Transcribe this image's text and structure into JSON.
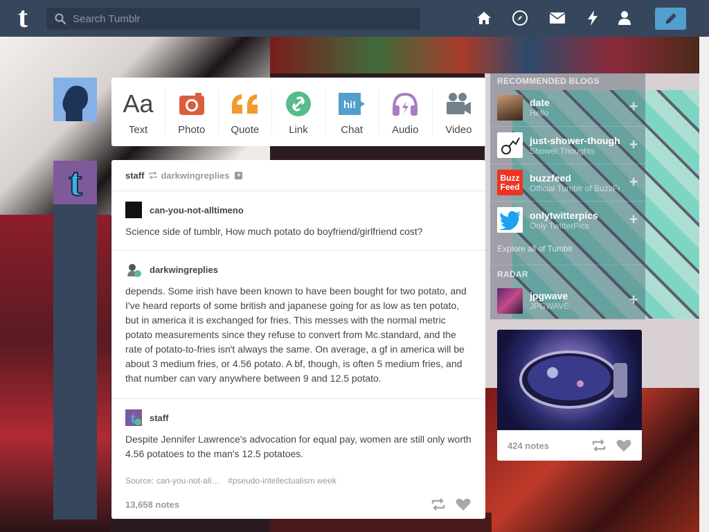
{
  "header": {
    "search_placeholder": "Search Tumblr",
    "logo_letter": "t",
    "nav_icons": [
      "home-icon",
      "explore-icon",
      "inbox-icon",
      "activity-icon",
      "account-icon"
    ],
    "compose_icon": "pencil-icon",
    "colors": {
      "bar": "#36465d",
      "accent": "#529ecc"
    }
  },
  "composer": {
    "buttons": [
      {
        "label": "Text",
        "icon": "Aa",
        "color": "#444444"
      },
      {
        "label": "Photo",
        "icon": "camera-icon",
        "color": "#d95e40"
      },
      {
        "label": "Quote",
        "icon": "quote-icon",
        "color": "#f2992e"
      },
      {
        "label": "Link",
        "icon": "link-icon",
        "color": "#56bc8a"
      },
      {
        "label": "Chat",
        "icon": "hi!",
        "color": "#529ecc"
      },
      {
        "label": "Audio",
        "icon": "headphones-icon",
        "color": "#a77dc2"
      },
      {
        "label": "Video",
        "icon": "video-camera-icon",
        "color": "#748089"
      }
    ]
  },
  "post": {
    "author": "staff",
    "reblogged_from": "darkwingreplies",
    "thread": [
      {
        "user": "can-you-not-alltimeno",
        "text": "Science side of tumblr, How much potato do boyfriend/girlfriend cost?"
      },
      {
        "user": "darkwingreplies",
        "text": "depends. Some irish have been known to have been bought for two potato, and I've heard reports of some british and japanese going for as low as ten potato, but in america it is exchanged for fries. This messes with the normal metric potato measurements since they refuse to convert from Mc.standard, and the rate of potato-to-fries isn't always the same. On average, a gf in america will be about 3 medium fries, or 4.56 potato. A bf, though, is often 5 medium fries, and that number can vary anywhere between 9 and 12.5 potato."
      },
      {
        "user": "staff",
        "text": "Despite Jennifer Lawrence's advocation for equal pay, women are still only worth 4.56 potatoes to the man's 12.5 potatoes."
      }
    ],
    "source": "Source: can-you-not-all…",
    "tag": "#pseudo-intellectualism week",
    "notes": "13,658 notes"
  },
  "sidebar": {
    "recommended_heading": "RECOMMENDED BLOGS",
    "blogs": [
      {
        "name": "date",
        "subtitle": "Hello"
      },
      {
        "name": "just-shower-thoughts",
        "subtitle": "Shower Thoughts"
      },
      {
        "name": "buzzfeed",
        "subtitle": "Official Tumblr of BuzzFeed",
        "logo_text": "Buzz Feed"
      },
      {
        "name": "onlytwitterpics",
        "subtitle": "Only TwitterPics"
      }
    ],
    "explore_label": "Explore all of Tumblr",
    "radar_heading": "RADAR",
    "radar": {
      "name": "jpgwave",
      "subtitle": "JPGWAVE",
      "notes": "424 notes"
    }
  }
}
